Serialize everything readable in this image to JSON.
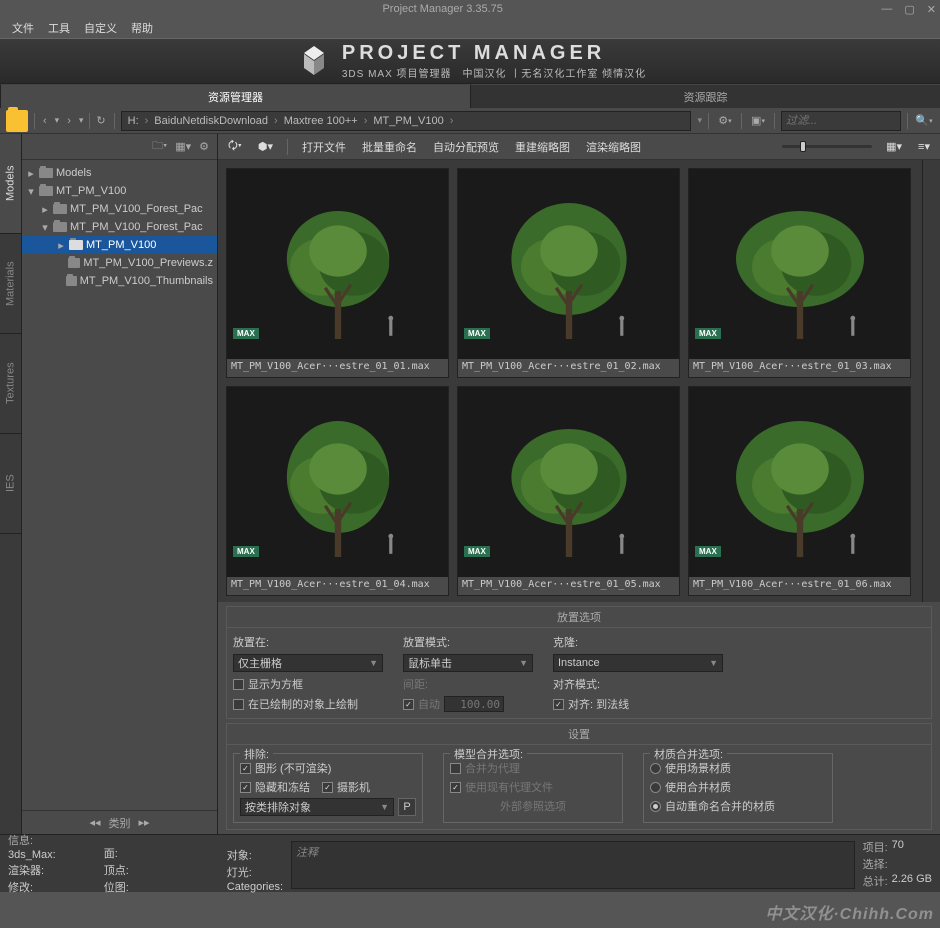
{
  "window": {
    "title": "Project Manager 3.35.75"
  },
  "menu": {
    "file": "文件",
    "tools": "工具",
    "custom": "自定义",
    "help": "帮助"
  },
  "logo": {
    "big": "PROJECT MANAGER",
    "small": "3DS MAX 项目管理器　中国汉化 丨无名汉化工作室 倾情汉化"
  },
  "tabs": {
    "explorer": "资源管理器",
    "tracker": "资源跟踪"
  },
  "vtabs": {
    "models": "Models",
    "materials": "Materials",
    "textures": "Textures",
    "ies": "IES"
  },
  "breadcrumb": {
    "drive": "H:",
    "p1": "BaiduNetdiskDownload",
    "p2": "Maxtree 100++",
    "p3": "MT_PM_V100"
  },
  "filter": {
    "placeholder": "过滤..."
  },
  "tree": {
    "root1": "Models",
    "root2": "MT_PM_V100",
    "c1": "MT_PM_V100_Forest_Pac",
    "c2": "MT_PM_V100_Forest_Pac",
    "c3": "MT_PM_V100",
    "c4": "MT_PM_V100_Previews.z",
    "c5": "MT_PM_V100_Thumbnails",
    "footer": "类别"
  },
  "content_toolbar": {
    "open": "打开文件",
    "rename": "批量重命名",
    "autopreview": "自动分配预览",
    "rebuild": "重建缩略图",
    "render": "渲染缩略图"
  },
  "thumbs": [
    {
      "badge": "MAX",
      "name": "MT_PM_V100_Acer···estre_01_01.max"
    },
    {
      "badge": "MAX",
      "name": "MT_PM_V100_Acer···estre_01_02.max"
    },
    {
      "badge": "MAX",
      "name": "MT_PM_V100_Acer···estre_01_03.max"
    },
    {
      "badge": "MAX",
      "name": "MT_PM_V100_Acer···estre_01_04.max"
    },
    {
      "badge": "MAX",
      "name": "MT_PM_V100_Acer···estre_01_05.max"
    },
    {
      "badge": "MAX",
      "name": "MT_PM_V100_Acer···estre_01_06.max"
    }
  ],
  "placement": {
    "panel_title": "放置选项",
    "place_on_label": "放置在:",
    "place_on_value": "仅主栅格",
    "mode_label": "放置模式:",
    "mode_value": "鼠标单击",
    "clone_label": "克隆:",
    "clone_value": "Instance",
    "show_box": "显示为方框",
    "paint_on": "在已绘制的对象上绘制",
    "spacing_label": "间距:",
    "auto": "自动",
    "spacing_value": "100.00",
    "align_mode": "对齐模式:",
    "align_value": "对齐: 到法线"
  },
  "settings": {
    "panel_title": "设置",
    "exclude_legend": "排除:",
    "shapes": "图形 (不可渲染)",
    "hidden": "隐藏和冻结",
    "cameras": "摄影机",
    "exclude_mode": "按类排除对象",
    "p_btn": "P",
    "merge_legend": "模型合并选项:",
    "merge_proxy": "合并为代理",
    "use_existing": "使用现有代理文件",
    "external_ref": "外部参照选项",
    "mat_legend": "材质合并选项:",
    "use_scene": "使用场景材质",
    "use_merge": "使用合并材质",
    "auto_rename": "自动重命名合并的材质"
  },
  "status": {
    "info": "信息:",
    "l1a": "3ds_Max:",
    "l2a": "渲染器:",
    "l3a": "修改:",
    "l1b": "面:",
    "l2b": "顶点:",
    "l3b": "位图:",
    "l1c": "对象:",
    "l2c": "灯光:",
    "l3c": "Categories:",
    "comment": "注释",
    "items_lbl": "项目:",
    "items_val": "70",
    "sel_lbl": "选择:",
    "sel_val": "",
    "total_lbl": "总计:",
    "total_val": "2.26 GB"
  },
  "watermark": "中文汉化·Chihh.Com"
}
